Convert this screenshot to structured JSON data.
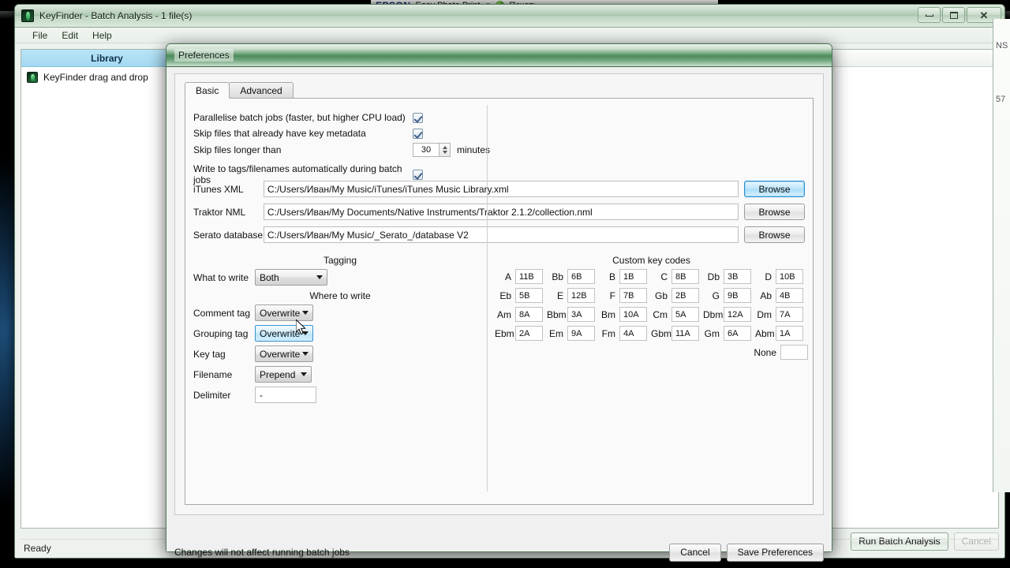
{
  "desktop": {
    "epson": {
      "logo": "EPSON",
      "app": "Easy Photo Print",
      "caret": "▼",
      "print_label": "Печать"
    },
    "bg_fragments": [
      "NS",
      "57"
    ]
  },
  "main_window": {
    "title": "KeyFinder - Batch Analysis - 1 file(s)",
    "icon": "keyfinder-icon",
    "menu": [
      "File",
      "Edit",
      "Help"
    ],
    "window_controls": {
      "minimize": "minimize-icon",
      "maximize": "maximize-icon",
      "close": "close-icon"
    },
    "library": {
      "header": "Library",
      "items": [
        {
          "label": "KeyFinder drag and drop",
          "icon": "keyfinder-icon"
        }
      ]
    },
    "buttons": {
      "run": "Run Batch Analysis",
      "cancel": "Cancel"
    },
    "status": "Ready"
  },
  "dialog": {
    "title": "Preferences",
    "tabs": [
      {
        "label": "Basic",
        "active": true
      },
      {
        "label": "Advanced",
        "active": false
      }
    ],
    "basic": {
      "checkboxes": [
        {
          "label": "Parallelise batch jobs (faster, but higher CPU load)",
          "checked": true
        },
        {
          "label": "Skip files that already have key metadata",
          "checked": true
        }
      ],
      "skip_longer": {
        "label": "Skip files longer than",
        "value": "30",
        "unit": "minutes"
      },
      "write_tags": {
        "label": "Write to tags/filenames automatically during batch jobs",
        "checked": true
      },
      "paths": [
        {
          "label": "iTunes XML",
          "value": "C:/Users/Иван/My Music/iTunes/iTunes Music Library.xml",
          "browse": "Browse",
          "focused": true
        },
        {
          "label": "Traktor NML",
          "value": "C:/Users/Иван/My Documents/Native Instruments/Traktor 2.1.2/collection.nml",
          "browse": "Browse",
          "focused": false
        },
        {
          "label": "Serato database",
          "value": "C:/Users/Иван/My Music/_Serato_/database V2",
          "browse": "Browse",
          "focused": false
        }
      ],
      "tagging": {
        "title": "Tagging",
        "what_to_write": {
          "label": "What to write",
          "value": "Both"
        },
        "where_to_write_title": "Where to write",
        "fields": [
          {
            "label": "Comment tag",
            "value": "Overwrite",
            "hover": false
          },
          {
            "label": "Grouping tag",
            "value": "Overwrite",
            "hover": true
          },
          {
            "label": "Key tag",
            "value": "Overwrite",
            "hover": false
          },
          {
            "label": "Filename",
            "value": "Prepend",
            "hover": false
          }
        ],
        "delimiter": {
          "label": "Delimiter",
          "value": "-"
        }
      },
      "custom_key_codes": {
        "title": "Custom key codes",
        "rows": [
          [
            {
              "label": "A",
              "value": "11B"
            },
            {
              "label": "Bb",
              "value": "6B"
            },
            {
              "label": "B",
              "value": "1B"
            },
            {
              "label": "C",
              "value": "8B"
            },
            {
              "label": "Db",
              "value": "3B"
            },
            {
              "label": "D",
              "value": "10B"
            }
          ],
          [
            {
              "label": "Eb",
              "value": "5B"
            },
            {
              "label": "E",
              "value": "12B"
            },
            {
              "label": "F",
              "value": "7B"
            },
            {
              "label": "Gb",
              "value": "2B"
            },
            {
              "label": "G",
              "value": "9B"
            },
            {
              "label": "Ab",
              "value": "4B"
            }
          ],
          [
            {
              "label": "Am",
              "value": "8A"
            },
            {
              "label": "Bbm",
              "value": "3A"
            },
            {
              "label": "Bm",
              "value": "10A"
            },
            {
              "label": "Cm",
              "value": "5A"
            },
            {
              "label": "Dbm",
              "value": "12A"
            },
            {
              "label": "Dm",
              "value": "7A"
            }
          ],
          [
            {
              "label": "Ebm",
              "value": "2A"
            },
            {
              "label": "Em",
              "value": "9A"
            },
            {
              "label": "Fm",
              "value": "4A"
            },
            {
              "label": "Gbm",
              "value": "11A"
            },
            {
              "label": "Gm",
              "value": "6A"
            },
            {
              "label": "Abm",
              "value": "1A"
            }
          ]
        ],
        "none": {
          "label": "None",
          "value": ""
        }
      }
    },
    "footer": {
      "note": "Changes will not affect running batch jobs",
      "cancel": "Cancel",
      "save": "Save Preferences"
    }
  },
  "colors": {
    "aero_green": "#4d8a5c",
    "library_header": "#a4d9f2",
    "focus_blue": "#2a8fd0",
    "hover_blue": "#3c93cd"
  }
}
